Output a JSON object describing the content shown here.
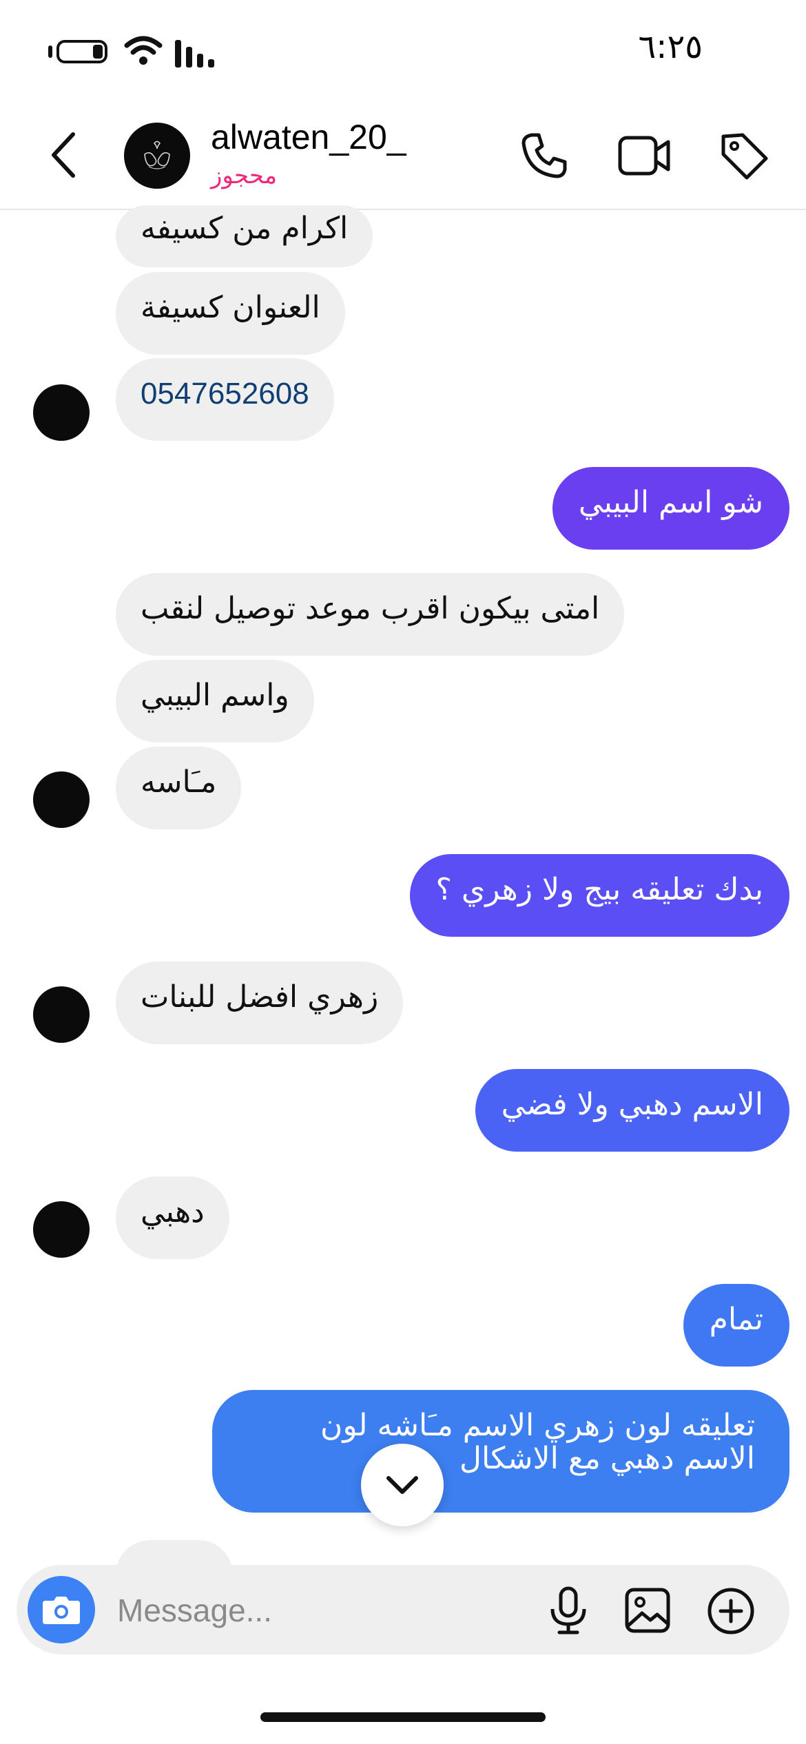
{
  "status_bar": {
    "time": "٦:٢٥"
  },
  "header": {
    "username": "alwaten_20_",
    "status": "محجوز",
    "icons": [
      "back-chevron-icon",
      "phone-icon",
      "video-camera-icon",
      "tag-icon"
    ]
  },
  "messages": [
    {
      "side": "in",
      "text": "اكرام من كسيفه"
    },
    {
      "side": "in",
      "text": "العنوان كسيفة"
    },
    {
      "side": "in",
      "text": "0547652608"
    },
    {
      "side": "out",
      "text": "شو اسم البيبي"
    },
    {
      "side": "in",
      "text": "امتى بيكون اقرب موعد توصيل لنقب"
    },
    {
      "side": "in",
      "text": "واسم البيبي"
    },
    {
      "side": "in",
      "text": "مـَاسه"
    },
    {
      "side": "out",
      "text": "بدك تعليقه بيج ولا زهري ؟"
    },
    {
      "side": "in",
      "text": "زهري افضل للبنات"
    },
    {
      "side": "out",
      "text": "الاسم دهبي ولا فضي"
    },
    {
      "side": "in",
      "text": "دهبي"
    },
    {
      "side": "out",
      "text": "تمام"
    },
    {
      "side": "out",
      "text": "تعليقه لون زهري الاسم مـَاشه لون الاسم دهبي مع الاشكال"
    }
  ],
  "composer": {
    "placeholder": "Message..."
  },
  "colors": {
    "status_pink": "#f0287a",
    "out_bubble_gradient": [
      "#6a3ff0",
      "#5a4ef4",
      "#4a63f4",
      "#3d7ff0"
    ],
    "in_bubble": "#efefef",
    "camera_button": "#3d82f5",
    "phone_number_link": "#123f73"
  }
}
